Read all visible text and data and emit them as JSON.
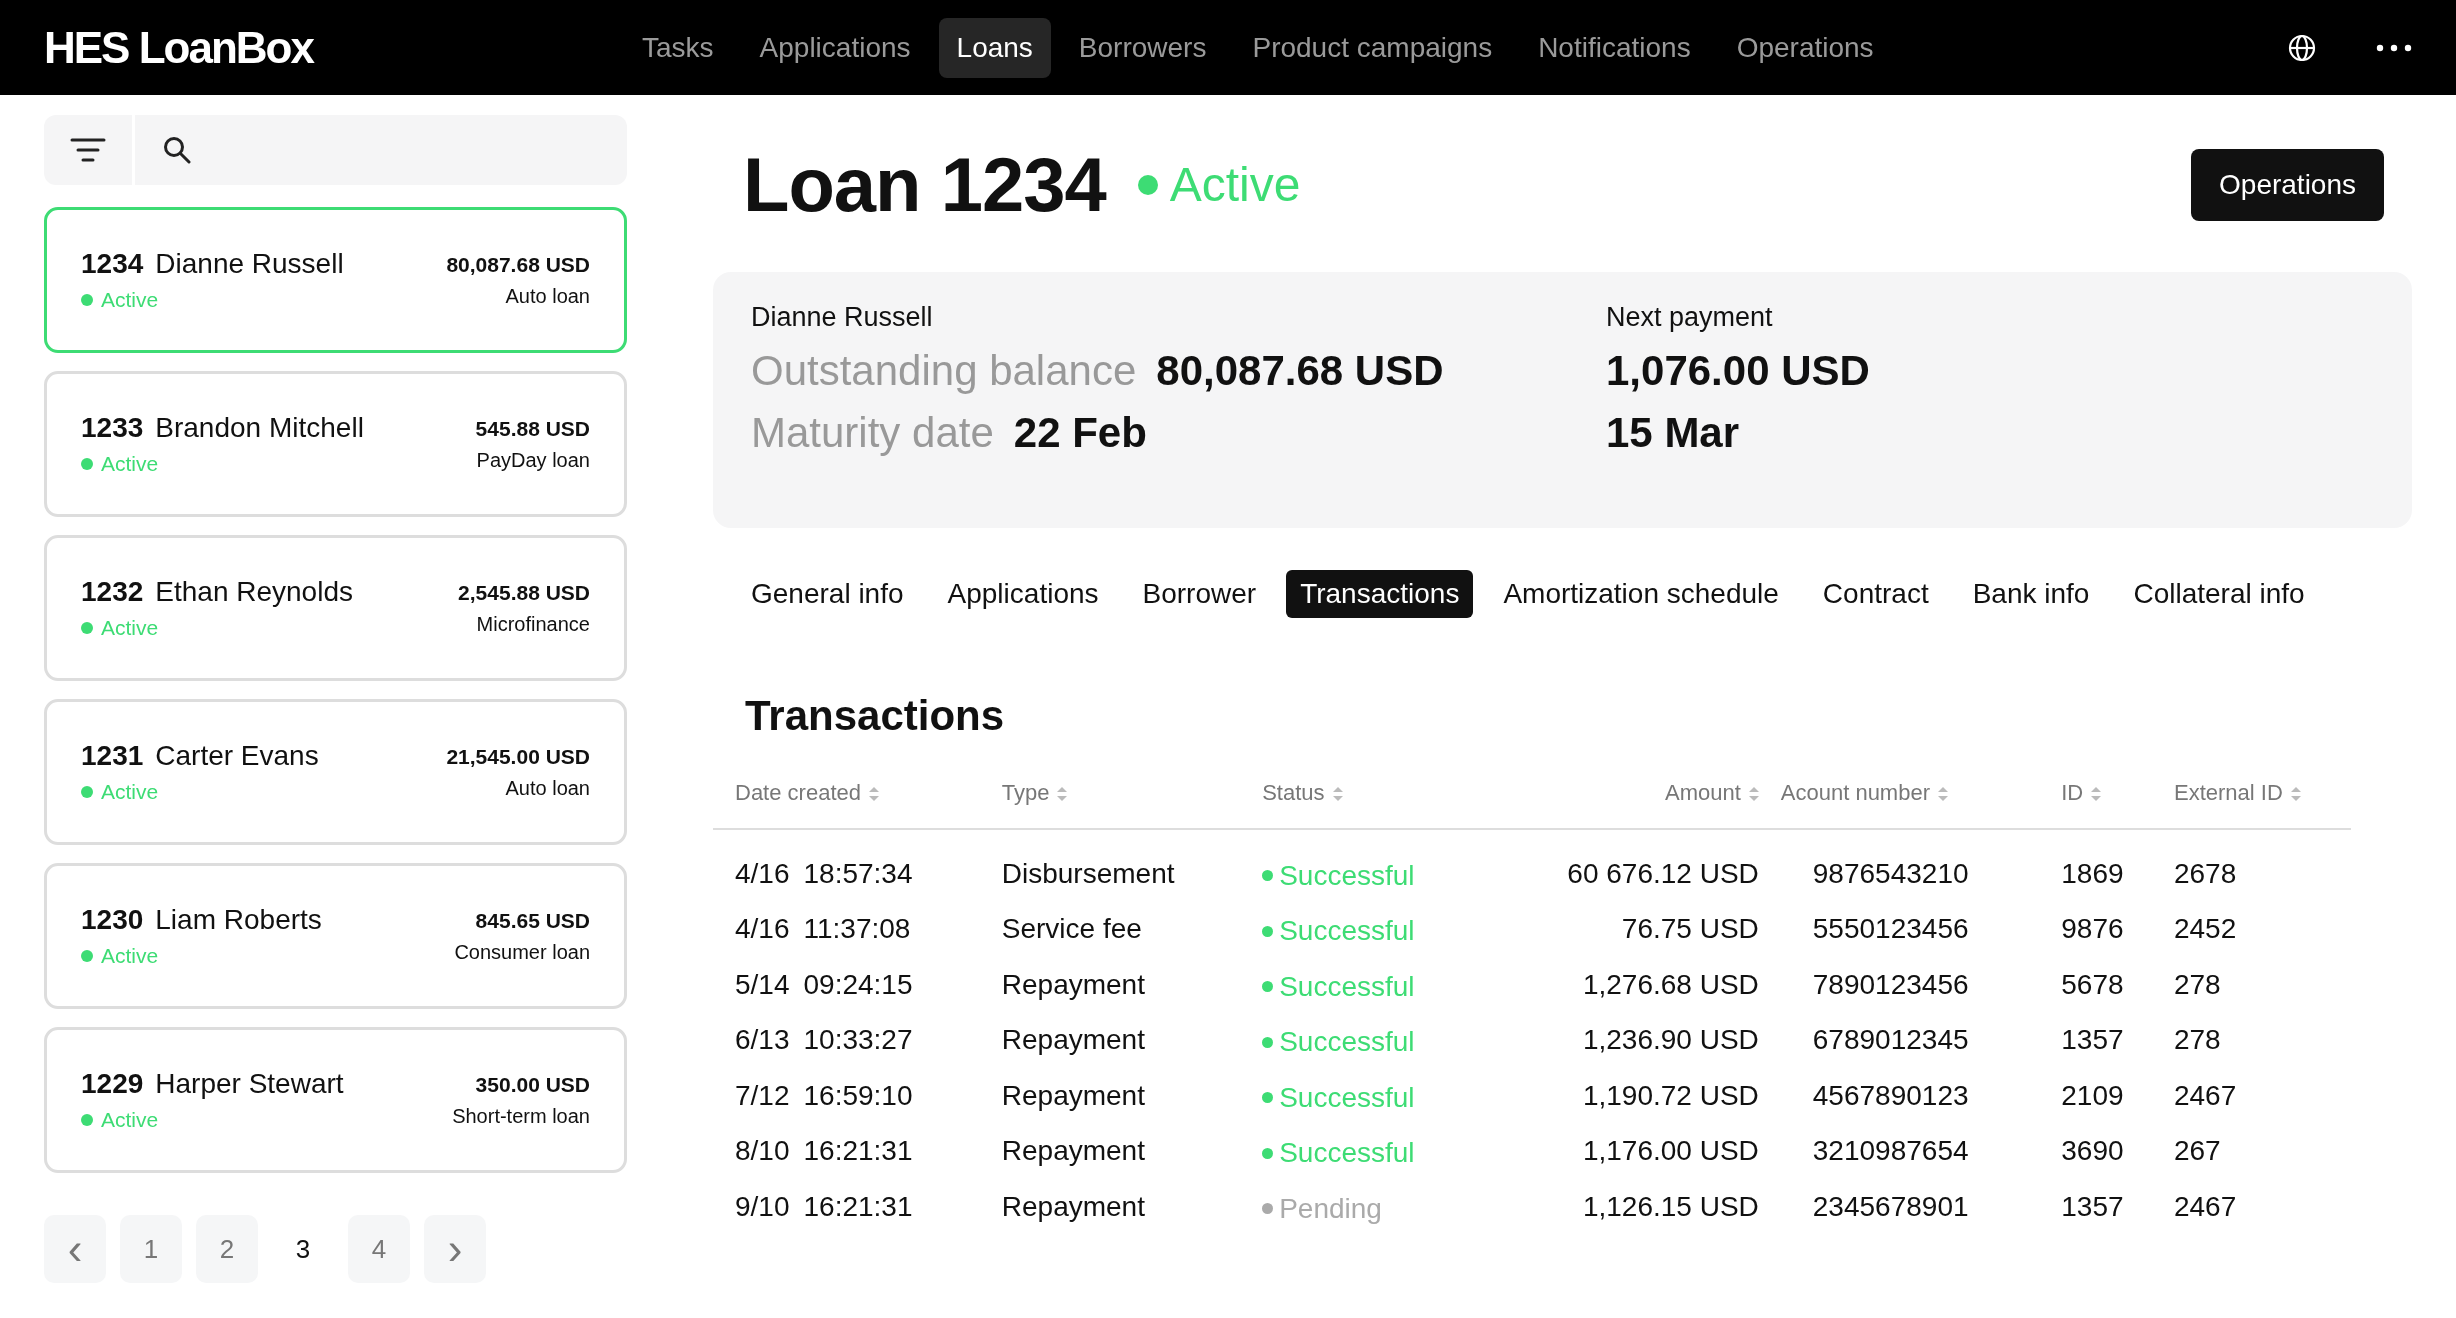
{
  "app": {
    "logo": "HES LoanBox"
  },
  "nav": [
    {
      "label": "Tasks",
      "selected": false
    },
    {
      "label": "Applications",
      "selected": false
    },
    {
      "label": "Loans",
      "selected": true
    },
    {
      "label": "Borrowers",
      "selected": false
    },
    {
      "label": "Product campaigns",
      "selected": false
    },
    {
      "label": "Notifications",
      "selected": false
    },
    {
      "label": "Operations",
      "selected": false
    }
  ],
  "loans": [
    {
      "number": "1234",
      "name": "Dianne Russell",
      "status": "Active",
      "amount": "80,087.68 USD",
      "product": "Auto loan",
      "selected": true
    },
    {
      "number": "1233",
      "name": "Brandon Mitchell",
      "status": "Active",
      "amount": "545.88 USD",
      "product": "PayDay loan",
      "selected": false
    },
    {
      "number": "1232",
      "name": "Ethan Reynolds",
      "status": "Active",
      "amount": "2,545.88 USD",
      "product": "Microfinance",
      "selected": false
    },
    {
      "number": "1231",
      "name": "Carter Evans",
      "status": "Active",
      "amount": "21,545.00 USD",
      "product": "Auto loan",
      "selected": false
    },
    {
      "number": "1230",
      "name": "Liam Roberts",
      "status": "Active",
      "amount": "845.65 USD",
      "product": "Consumer loan",
      "selected": false
    },
    {
      "number": "1229",
      "name": "Harper Stewart",
      "status": "Active",
      "amount": "350.00 USD",
      "product": "Short-term loan",
      "selected": false
    }
  ],
  "pagination": {
    "prev": "‹",
    "next": "›",
    "pages": [
      {
        "label": "1",
        "selected": false
      },
      {
        "label": "2",
        "selected": false
      },
      {
        "label": "3",
        "selected": true
      },
      {
        "label": "4",
        "selected": false
      }
    ]
  },
  "loan": {
    "title": "Loan 1234",
    "status": "Active",
    "action": "Operations"
  },
  "summary": {
    "borrower": "Dianne Russell",
    "balance_label": "Outstanding balance",
    "balance": "80,087.68 USD",
    "maturity_label": "Maturity date",
    "maturity": "22 Feb",
    "next_label": "Next payment",
    "next_amount": "1,076.00 USD",
    "next_date": "15 Mar"
  },
  "tabs": [
    {
      "label": "General info",
      "selected": false
    },
    {
      "label": "Applications",
      "selected": false
    },
    {
      "label": "Borrower",
      "selected": false
    },
    {
      "label": "Transactions",
      "selected": true
    },
    {
      "label": "Amortization schedule",
      "selected": false
    },
    {
      "label": "Contract",
      "selected": false
    },
    {
      "label": "Bank info",
      "selected": false
    },
    {
      "label": "Collateral info",
      "selected": false
    }
  ],
  "transactions": {
    "title": "Transactions",
    "columns": [
      "Date created",
      "Type",
      "Status",
      "Amount",
      "Acount number",
      "ID",
      "External ID"
    ],
    "rows": [
      {
        "date": "4/16",
        "time": "18:57:34",
        "type": "Disbursement",
        "status": "Successful",
        "kind": "success",
        "amount": "60 676.12 USD",
        "account": "9876543210",
        "id": "1869",
        "external_id": "2678"
      },
      {
        "date": "4/16",
        "time": "11:37:08",
        "type": "Service fee",
        "status": "Successful",
        "kind": "success",
        "amount": "76.75 USD",
        "account": "5550123456",
        "id": "9876",
        "external_id": "2452"
      },
      {
        "date": "5/14",
        "time": "09:24:15",
        "type": "Repayment",
        "status": "Successful",
        "kind": "success",
        "amount": "1,276.68 USD",
        "account": "7890123456",
        "id": "5678",
        "external_id": "278"
      },
      {
        "date": "6/13",
        "time": "10:33:27",
        "type": "Repayment",
        "status": "Successful",
        "kind": "success",
        "amount": "1,236.90 USD",
        "account": "6789012345",
        "id": "1357",
        "external_id": "278"
      },
      {
        "date": "7/12",
        "time": "16:59:10",
        "type": "Repayment",
        "status": "Successful",
        "kind": "success",
        "amount": "1,190.72 USD",
        "account": "4567890123",
        "id": "2109",
        "external_id": "2467"
      },
      {
        "date": "8/10",
        "time": "16:21:31",
        "type": "Repayment",
        "status": "Successful",
        "kind": "success",
        "amount": "1,176.00 USD",
        "account": "3210987654",
        "id": "3690",
        "external_id": "267"
      },
      {
        "date": "9/10",
        "time": "16:21:31",
        "type": "Repayment",
        "status": "Pending",
        "kind": "pending",
        "amount": "1,126.15 USD",
        "account": "2345678901",
        "id": "1357",
        "external_id": "2467"
      }
    ]
  }
}
